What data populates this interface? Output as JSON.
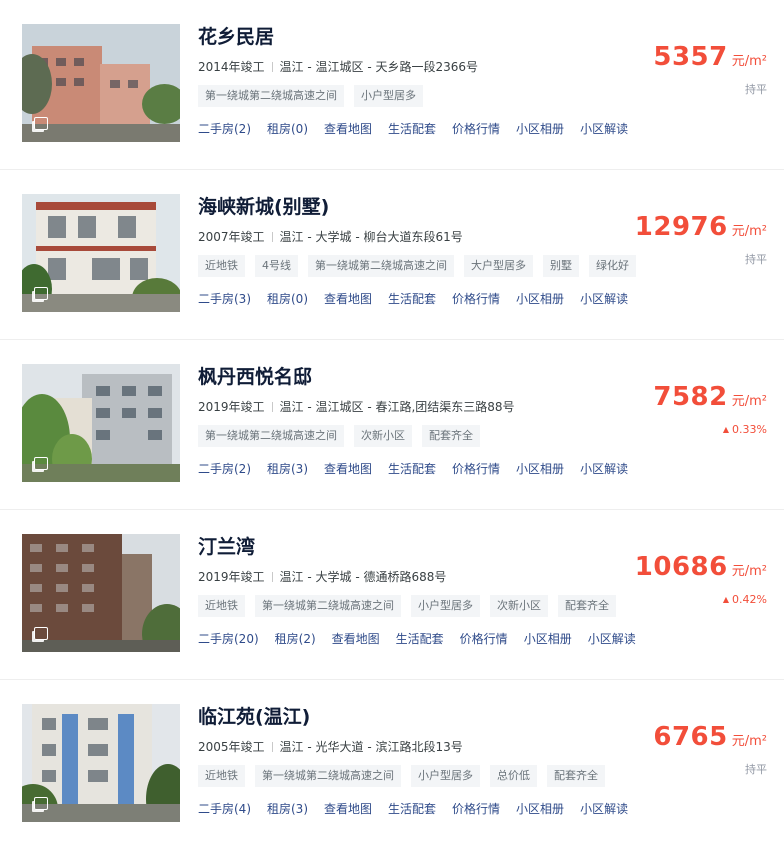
{
  "colors": {
    "price": "#f24e3a",
    "link": "#2f4b8a",
    "title": "#101d37",
    "tag_bg": "#f3f5f7"
  },
  "items": [
    {
      "name": "花乡民居",
      "year": "2014年竣工",
      "location": "温江 - 温江城区 - 天乡路一段2366号",
      "tags": [
        "第一绕城第二绕城高速之间",
        "小户型居多"
      ],
      "links": [
        "二手房(2)",
        "租房(0)",
        "查看地图",
        "生活配套",
        "价格行情",
        "小区相册",
        "小区解读"
      ],
      "price": "5357",
      "unit": "元/m²",
      "trend": "持平",
      "trend_dir": "flat"
    },
    {
      "name": "海峡新城(别墅)",
      "year": "2007年竣工",
      "location": "温江 - 大学城 - 柳台大道东段61号",
      "tags": [
        "近地铁",
        "4号线",
        "第一绕城第二绕城高速之间",
        "大户型居多",
        "别墅",
        "绿化好"
      ],
      "links": [
        "二手房(3)",
        "租房(0)",
        "查看地图",
        "生活配套",
        "价格行情",
        "小区相册",
        "小区解读"
      ],
      "price": "12976",
      "unit": "元/m²",
      "trend": "持平",
      "trend_dir": "flat"
    },
    {
      "name": "枫丹西悦名邸",
      "year": "2019年竣工",
      "location": "温江 - 温江城区 - 春江路,团结渠东三路88号",
      "tags": [
        "第一绕城第二绕城高速之间",
        "次新小区",
        "配套齐全"
      ],
      "links": [
        "二手房(2)",
        "租房(3)",
        "查看地图",
        "生活配套",
        "价格行情",
        "小区相册",
        "小区解读"
      ],
      "price": "7582",
      "unit": "元/m²",
      "trend": "0.33%",
      "trend_dir": "up"
    },
    {
      "name": "汀兰湾",
      "year": "2019年竣工",
      "location": "温江 - 大学城 - 德通桥路688号",
      "tags": [
        "近地铁",
        "第一绕城第二绕城高速之间",
        "小户型居多",
        "次新小区",
        "配套齐全"
      ],
      "links": [
        "二手房(20)",
        "租房(2)",
        "查看地图",
        "生活配套",
        "价格行情",
        "小区相册",
        "小区解读"
      ],
      "price": "10686",
      "unit": "元/m²",
      "trend": "0.42%",
      "trend_dir": "up"
    },
    {
      "name": "临江苑(温江)",
      "year": "2005年竣工",
      "location": "温江 - 光华大道 - 滨江路北段13号",
      "tags": [
        "近地铁",
        "第一绕城第二绕城高速之间",
        "小户型居多",
        "总价低",
        "配套齐全"
      ],
      "links": [
        "二手房(4)",
        "租房(3)",
        "查看地图",
        "生活配套",
        "价格行情",
        "小区相册",
        "小区解读"
      ],
      "price": "6765",
      "unit": "元/m²",
      "trend": "持平",
      "trend_dir": "flat"
    }
  ]
}
